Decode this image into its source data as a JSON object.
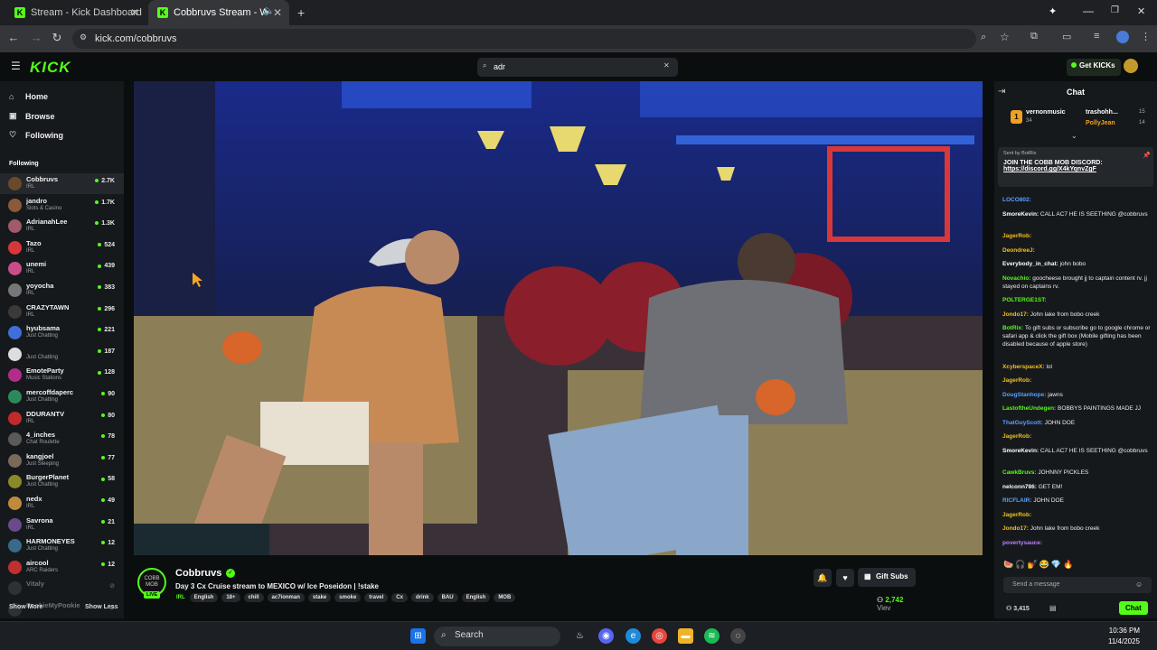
{
  "browser": {
    "tabs": [
      {
        "title": "Stream - Kick Dashboard",
        "active": false
      },
      {
        "title": "Cobbruvs Stream - Watch L",
        "active": true
      }
    ],
    "url": "kick.com/cobbruvs"
  },
  "header": {
    "logo": "KICK",
    "search_value": "adr",
    "get_kicks_label": "Get KICKs"
  },
  "sidebar": {
    "nav": [
      {
        "label": "Home",
        "icon": "home-icon"
      },
      {
        "label": "Browse",
        "icon": "browse-icon"
      },
      {
        "label": "Following",
        "icon": "heart-icon"
      }
    ],
    "following_title": "Following",
    "channels": [
      {
        "name": "Cobbruvs",
        "category": "IRL",
        "viewers": "2.7K",
        "color": "#6b4a2b"
      },
      {
        "name": "jandro",
        "category": "Slots & Casino",
        "viewers": "1.7K",
        "color": "#8a5a3b"
      },
      {
        "name": "AdrianahLee",
        "category": "IRL",
        "viewers": "1.3K",
        "color": "#a05a6a"
      },
      {
        "name": "Tazo",
        "category": "IRL",
        "viewers": "524",
        "color": "#d6373a"
      },
      {
        "name": "unemi",
        "category": "IRL",
        "viewers": "439",
        "color": "#c84d8a"
      },
      {
        "name": "yoyocha",
        "category": "IRL",
        "viewers": "383",
        "color": "#777"
      },
      {
        "name": "CRAZYTAWN",
        "category": "IRL",
        "viewers": "296",
        "color": "#3a3a3a"
      },
      {
        "name": "hyubsama",
        "category": "Just Chatting",
        "viewers": "221",
        "color": "#3f6fd8"
      },
      {
        "name": "",
        "category": "Just Chatting",
        "viewers": "187",
        "color": "#ddd"
      },
      {
        "name": "EmoteParty",
        "category": "Music Stations",
        "viewers": "128",
        "color": "#b02e8a"
      },
      {
        "name": "mercoffdaperc",
        "category": "Just Chatting",
        "viewers": "90",
        "color": "#2c8a5a"
      },
      {
        "name": "DDURANTV",
        "category": "IRL",
        "viewers": "80",
        "color": "#c02a2a"
      },
      {
        "name": "4_inches",
        "category": "Chat Roulette",
        "viewers": "78",
        "color": "#5a5a5a"
      },
      {
        "name": "kangjoel",
        "category": "Just Sleeping",
        "viewers": "77",
        "color": "#7a6a5a"
      },
      {
        "name": "BurgerPlanet",
        "category": "Just Chatting",
        "viewers": "58",
        "color": "#8a8a2a"
      },
      {
        "name": "nedx",
        "category": "IRL",
        "viewers": "49",
        "color": "#c08a3a"
      },
      {
        "name": "Savrona",
        "category": "IRL",
        "viewers": "21",
        "color": "#6a4a8a"
      },
      {
        "name": "HARMONEYES",
        "category": "Just Chatting",
        "viewers": "12",
        "color": "#3a6a8a"
      },
      {
        "name": "aircool",
        "category": "ARC Raiders",
        "viewers": "12",
        "color": "#c03030"
      },
      {
        "name": "Vitaly",
        "category": "",
        "viewers": "",
        "color": "#555",
        "offline": true
      },
      {
        "name": "PookieMyPookie",
        "category": "",
        "viewers": "",
        "color": "#555",
        "offline": true
      }
    ],
    "show_more": "Show More",
    "show_less": "Show Less"
  },
  "stream": {
    "channel_name": "Cobbruvs",
    "live_badge": "LIVE",
    "title": "Day 3 Cx Cruise stream to MEXICO w/ Ice Poseidon | !stake",
    "category": "IRL",
    "tags": [
      "English",
      "18+",
      "chill",
      "ac7ionman",
      "stake",
      "smoke",
      "travel",
      "Cx",
      "drink",
      "BAU",
      "English",
      "MOB"
    ],
    "gift_subs_label": "Gift Subs",
    "viewer_count": "2,742",
    "viewers_suffix": "Viev"
  },
  "chat": {
    "title": "Chat",
    "leaderboard": [
      {
        "name": "vernonmusic",
        "value": "34"
      },
      {
        "name": "trashohh...",
        "value": "15"
      },
      {
        "name": "PollyJean",
        "value": "14"
      }
    ],
    "pinned_by": "Sent by BotRix",
    "pinned_message": "JOIN THE COBB MOB DISCORD:",
    "pinned_link": "https://discord.gg/X4kYqnvZgF",
    "messages": [
      {
        "user": "LOCO802:",
        "text": "",
        "color": "#5aa0ff"
      },
      {
        "user": "SmoreKevin:",
        "text": "CALL AC7 HE IS SEETHING @cobbruvs",
        "color": "#ffffff"
      },
      {
        "user": "JagerRob:",
        "text": "",
        "color": "#f0c020"
      },
      {
        "user": "DeondreeJ:",
        "text": "",
        "color": "#f0c020"
      },
      {
        "user": "Everybody_in_chat:",
        "text": "john bobo",
        "color": "#ffffff"
      },
      {
        "user": "Novachio:",
        "text": "goocheese brought jj to captain content rv. jj stayed on captains rv.",
        "color": "#53fc18"
      },
      {
        "user": "POLTERGE1ST:",
        "text": "",
        "color": "#53fc18"
      },
      {
        "user": "Jondo17:",
        "text": "John lake from bobo creek",
        "color": "#f0c020"
      },
      {
        "user": "BotRix:",
        "text": "To gift subs or subscribe go to google chrome or safari app & click the gift box (Mobile gifting has been disabled because of apple store)",
        "color": "#53fc18"
      },
      {
        "user": "XcyberspaceX:",
        "text": "lol",
        "color": "#f0c020"
      },
      {
        "user": "JagerRob:",
        "text": "",
        "color": "#f0c020"
      },
      {
        "user": "DougStanhope:",
        "text": "jawns",
        "color": "#5aa0ff"
      },
      {
        "user": "LastoftheUndegen:",
        "text": "BOBBYS PAINTINGS MADE JJ",
        "color": "#53fc18"
      },
      {
        "user": "ThatGuyScott:",
        "text": "JOHN DOE",
        "color": "#5aa0ff"
      },
      {
        "user": "JagerRob:",
        "text": "",
        "color": "#f0c020"
      },
      {
        "user": "SmoreKevin:",
        "text": "CALL AC7 HE IS SEETHING @cobbruvs",
        "color": "#ffffff"
      },
      {
        "user": "CawkBruvs:",
        "text": "JOHNNY PICKLES",
        "color": "#53fc18"
      },
      {
        "user": "nelconn786:",
        "text": "GET EM!",
        "color": "#ffffff"
      },
      {
        "user": "RICFLAIR:",
        "text": "JOHN DOE",
        "color": "#5aa0ff"
      },
      {
        "user": "JagerRob:",
        "text": "",
        "color": "#f0c020"
      },
      {
        "user": "Jondo17:",
        "text": "John lake from bobo creek",
        "color": "#f0c020"
      },
      {
        "user": "povertysauce:",
        "text": "",
        "color": "#c080ff"
      }
    ],
    "send_placeholder": "Send a message",
    "chat_button": "Chat",
    "points": "3,415"
  },
  "taskbar": {
    "search_label": "Search",
    "time": "10:36 PM",
    "date": "11/4/2025"
  }
}
